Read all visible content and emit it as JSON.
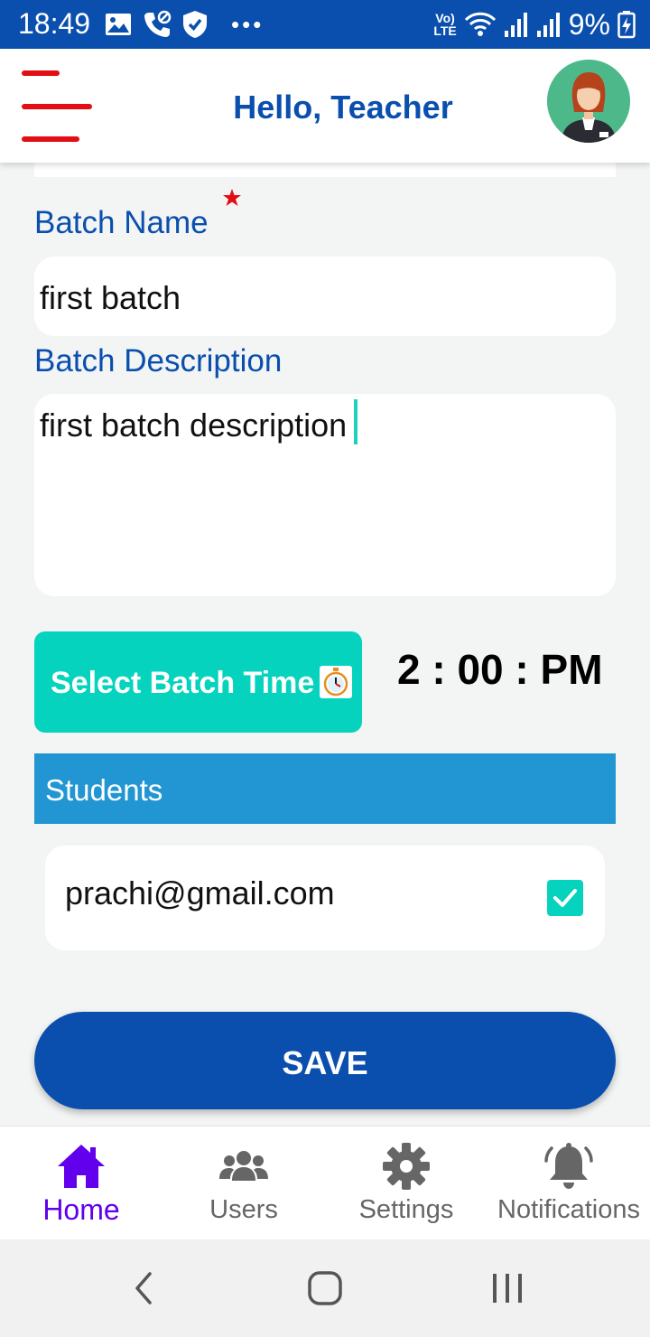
{
  "status_bar": {
    "time": "18:49",
    "lte_top": "Vo)",
    "lte_bottom": "LTE",
    "battery": "9%"
  },
  "header": {
    "title": "Hello, Teacher",
    "menu_icon": "hamburger-icon",
    "avatar_icon": "teacher-avatar"
  },
  "form": {
    "batch_name_label": "Batch Name",
    "batch_name_value": "first batch",
    "batch_description_label": "Batch Description",
    "batch_description_value": "first batch description",
    "select_time_label": "Select Batch Time",
    "selected_time": "2 : 00 : PM"
  },
  "students": {
    "header": "Students",
    "items": [
      {
        "email": "prachi@gmail.com",
        "checked": true
      }
    ]
  },
  "save_label": "SAVE",
  "bottom_nav": {
    "items": [
      {
        "label": "Home",
        "icon": "home-icon",
        "active": true
      },
      {
        "label": "Users",
        "icon": "users-icon",
        "active": false
      },
      {
        "label": "Settings",
        "icon": "gear-icon",
        "active": false
      },
      {
        "label": "Notifications",
        "icon": "bell-icon",
        "active": false
      }
    ]
  },
  "colors": {
    "primary": "#0a4fae",
    "accent_teal": "#05d3be",
    "students_header": "#2196d3",
    "active_nav": "#6200ee",
    "menu_red": "#e30d14"
  }
}
